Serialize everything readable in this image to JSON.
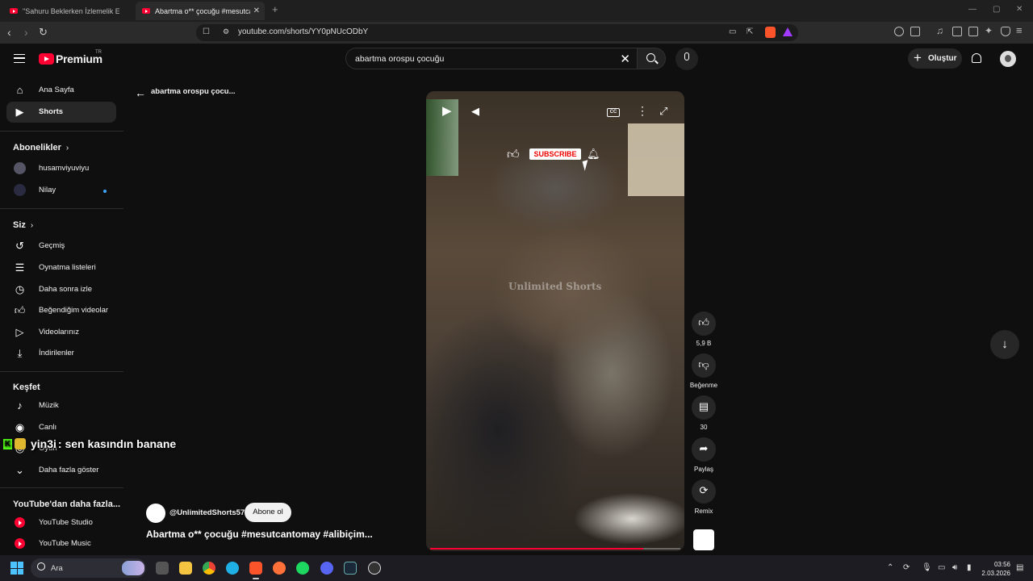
{
  "browser": {
    "tabs": [
      {
        "title": "\"Sahuru Beklerken İzlemelik Edit\" Kis..."
      },
      {
        "title": "Abartma o** çocuğu #mesutcan..."
      }
    ],
    "new_tab": "+",
    "url": "youtube.com/shorts/YY0pNUcODbY"
  },
  "header": {
    "logo": "Premium",
    "logo_region": "TR",
    "search_value": "abartma orospu çocuğu",
    "create_label": "Oluştur"
  },
  "sidebar": {
    "main": [
      {
        "label": "Ana Sayfa",
        "icon": "home-icon"
      },
      {
        "label": "Shorts",
        "icon": "shorts-icon"
      }
    ],
    "subscriptions_heading": "Abonelikler",
    "subscriptions": [
      {
        "label": "husamviyuviyu"
      },
      {
        "label": "Nilay"
      }
    ],
    "you_heading": "Siz",
    "you": [
      {
        "label": "Geçmiş",
        "icon": "history-icon"
      },
      {
        "label": "Oynatma listeleri",
        "icon": "playlist-icon"
      },
      {
        "label": "Daha sonra izle",
        "icon": "clock-icon"
      },
      {
        "label": "Beğendiğim videolar",
        "icon": "thumbs-up-icon"
      },
      {
        "label": "Videolarınız",
        "icon": "video-icon"
      },
      {
        "label": "İndirilenler",
        "icon": "download-icon"
      }
    ],
    "explore_heading": "Keşfet",
    "explore": [
      {
        "label": "Müzik",
        "icon": "music-icon"
      },
      {
        "label": "Canlı",
        "icon": "live-icon"
      },
      {
        "label": "Oyun",
        "icon": "game-icon"
      },
      {
        "label": "Daha fazla göster",
        "icon": "chevron-down-icon"
      }
    ],
    "more_heading": "YouTube'dan daha fazla...",
    "more": [
      {
        "label": "YouTube Studio"
      },
      {
        "label": "YouTube Music"
      }
    ]
  },
  "overlay_chat": {
    "user": "yin3i",
    "message": ": sen kasındın banane"
  },
  "shorts": {
    "back_title": "abartma orospu çocu...",
    "watermark": "Unlimited Shorts",
    "subscribe_badge": "SUBSCRIBE",
    "cc_label": "CC",
    "progress": 0.85,
    "likes": "5,9 B",
    "dislike_label": "Beğenme",
    "comments": "30",
    "share_label": "Paylaş",
    "remix_label": "Remix",
    "channel": "@UnlimitedShorts57",
    "subscribe_label": "Abone ol",
    "title": "Abartma o** çocuğu #mesutcantomay #alibiçim..."
  },
  "taskbar": {
    "search_label": "Ara",
    "time": "03:56",
    "date": "2.03.2026"
  }
}
